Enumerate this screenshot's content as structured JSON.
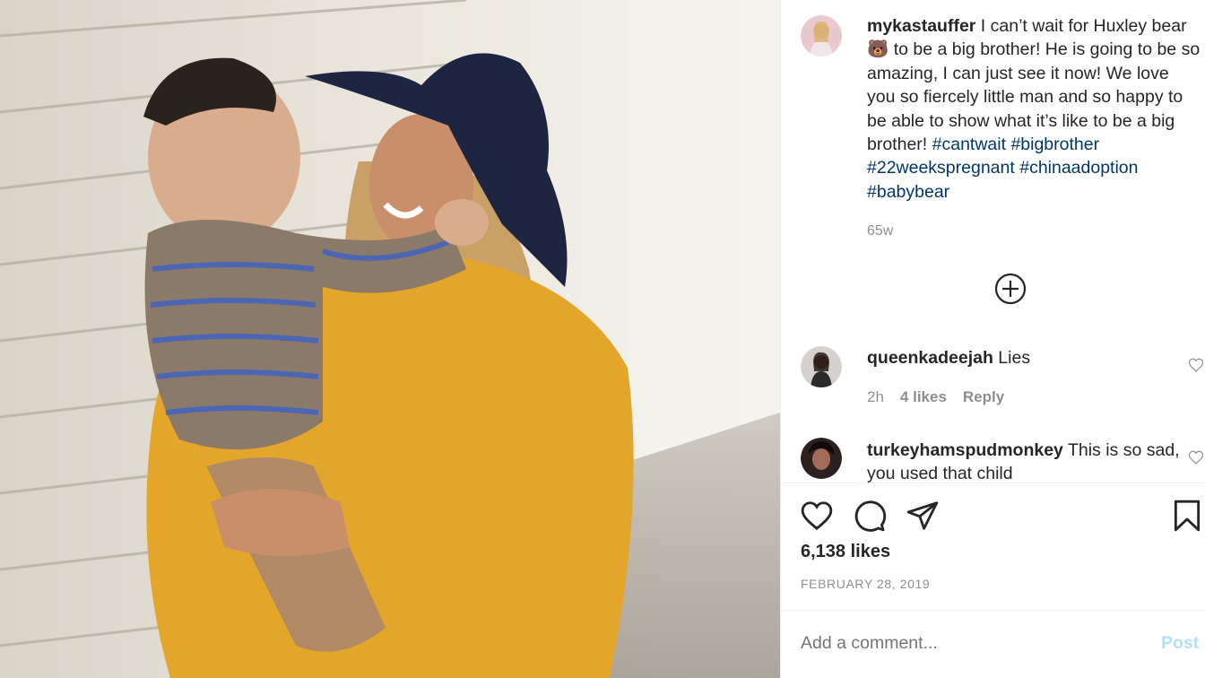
{
  "post": {
    "author": "mykastauffer",
    "caption_part1": " I can’t wait for Huxley bear 🐻 to be a big brother! He is going to be so amazing, I can just see it now! We love you so fiercely little man and so happy to be able to show what it’s like to be a big brother! ",
    "hashtags": [
      "#cantwait",
      "#bigbrother",
      "#22weekspregnant",
      "#chinaadoption",
      "#babybear"
    ],
    "age": "65w"
  },
  "comments": [
    {
      "user": "queenkadeejah",
      "text": " Lies",
      "age": "2h",
      "likes": "4 likes",
      "reply": "Reply"
    },
    {
      "user": "turkeyhamspudmonkey",
      "text": " This is so sad, you used that child"
    }
  ],
  "stats": {
    "likes": "6,138 likes",
    "date": "FEBRUARY 28, 2019"
  },
  "composer": {
    "placeholder": "Add a comment...",
    "post_label": "Post"
  },
  "icons": [
    "add-circle-icon",
    "heart-icon",
    "comment-icon",
    "share-icon",
    "bookmark-icon",
    "small-heart-icon"
  ],
  "colors": {
    "hashtag": "#00376b",
    "muted": "#8e8e8e",
    "post_button": "#b2dffc"
  }
}
